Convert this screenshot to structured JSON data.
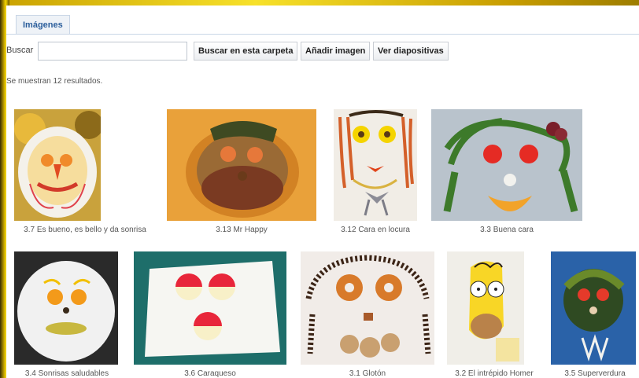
{
  "tab": {
    "label": "Imágenes"
  },
  "search": {
    "label": "Buscar",
    "value": "",
    "placeholder": ""
  },
  "toolbar": {
    "search_folder": "Buscar en esta carpeta",
    "add_image": "Añadir imagen",
    "slideshow": "Ver diapositivas"
  },
  "results_text": "Se muestran 12 resultados.",
  "gallery": [
    {
      "caption": "3.7 Es bueno, es bello y da sonrisa"
    },
    {
      "caption": "3.13 Mr Happy"
    },
    {
      "caption": "3.12 Cara en locura"
    },
    {
      "caption": "3.3 Buena cara"
    },
    {
      "caption": "3.4 Sonrisas saludables"
    },
    {
      "caption": "3.6 Caraqueso"
    },
    {
      "caption": "3.1 Glotón"
    },
    {
      "caption": "3.2 El intrépido Homer"
    },
    {
      "caption": "3.5 Superverdura"
    }
  ]
}
